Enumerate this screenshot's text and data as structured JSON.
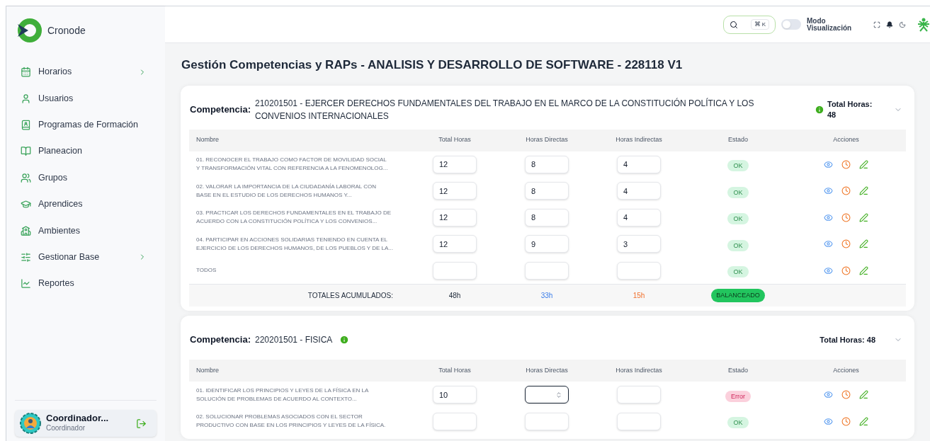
{
  "app": {
    "name": "Cronode"
  },
  "sidebar": {
    "items": [
      {
        "label": "Horarios",
        "has_submenu": true
      },
      {
        "label": "Usuarios",
        "has_submenu": false
      },
      {
        "label": "Programas de Formación",
        "has_submenu": false
      },
      {
        "label": "Planeacion",
        "has_submenu": false
      },
      {
        "label": "Grupos",
        "has_submenu": false
      },
      {
        "label": "Aprendices",
        "has_submenu": false
      },
      {
        "label": "Ambientes",
        "has_submenu": false
      },
      {
        "label": "Gestionar Base",
        "has_submenu": true
      },
      {
        "label": "Reportes",
        "has_submenu": false
      }
    ],
    "user": {
      "name": "Coordinador...",
      "role": "Coordinador"
    }
  },
  "header": {
    "search_shortcut_symbol": "⌘",
    "search_shortcut_key": "K",
    "mode_toggle": {
      "label": "Modo Visualización",
      "on": false
    }
  },
  "page_title": "Gestión Competencias y RAPs - ANALISIS Y DESARROLLO DE SOFTWARE - 228118 V1",
  "competencias": [
    {
      "label": "Competencia:",
      "title": "210201501 - EJERCER DERECHOS FUNDAMENTALES DEL TRABAJO EN EL MARCO DE LA CONSTITUCIÓN POLÍTICA Y LOS CONVENIOS INTERNACIONALES",
      "info_beside_total": true,
      "total": "Total Horas: 48",
      "expanded": true,
      "columns": [
        "Nombre",
        "Total Horas",
        "Horas Directas",
        "Horas Indirectas",
        "Estado",
        "Acciones"
      ],
      "rows": [
        {
          "name": "01. RECONOCER EL TRABAJO COMO FACTOR DE MOVILIDAD SOCIAL\nY TRANSFORMACIÓN VITAL CON REFERENCIA A LA FENOMENOLOG...",
          "total": "12",
          "directas": "8",
          "indirectas": "4",
          "focused": false,
          "error": false,
          "status_text": "OK"
        },
        {
          "name": "02. VALORAR LA IMPORTANCIA DE LA CIUDADANÍA LABORAL CON\nBASE EN EL ESTUDIO DE LOS DERECHOS HUMANOS Y...",
          "total": "12",
          "directas": "8",
          "indirectas": "4",
          "focused": false,
          "error": false,
          "status_text": "OK"
        },
        {
          "name": "03. PRACTICAR LOS DERECHOS FUNDAMENTALES EN EL TRABAJO DE\nACUERDO CON LA CONSTITUCIÓN POLÍTICA Y LOS CONVENIOS...",
          "total": "12",
          "directas": "8",
          "indirectas": "4",
          "focused": false,
          "error": false,
          "status_text": "OK"
        },
        {
          "name": "04. PARTICIPAR EN ACCIONES SOLIDARIAS TENIENDO EN CUENTA EL\nEJERCICIO DE LOS DERECHOS HUMANOS, DE LOS PUEBLOS Y DE LA...",
          "total": "12",
          "directas": "9",
          "indirectas": "3",
          "focused": false,
          "error": false,
          "status_text": "OK"
        },
        {
          "name": "TODOS",
          "focused": false,
          "error": false,
          "status_text": "OK"
        }
      ],
      "totals": {
        "label": "TOTALES ACUMULADOS:",
        "total": "48h",
        "directas": "33h",
        "indirectas": "15h",
        "status": "BALANCEADO"
      }
    },
    {
      "label": "Competencia:",
      "title": "220201501 - FISICA",
      "info_beside_total": false,
      "total": "Total Horas: 48",
      "expanded": true,
      "columns": [
        "Nombre",
        "Total Horas",
        "Horas Directas",
        "Horas Indirectas",
        "Estado",
        "Acciones"
      ],
      "rows": [
        {
          "name": "01. IDENTIFICAR LOS PRINCIPIOS Y LEYES DE LA FÍSICA EN LA\nSOLUCIÓN DE PROBLEMAS DE ACUERDO AL CONTEXTO...",
          "total": "10",
          "focused": true,
          "error": true,
          "status_text": "Error"
        },
        {
          "name": "02. SOLUCIONAR PROBLEMAS ASOCIADOS CON EL SECTOR\nPRODUCTIVO CON BASE EN LOS PRINCIPIOS Y LEYES DE LA FÍSICA.",
          "focused": false,
          "error": false,
          "status_text": "OK"
        }
      ]
    }
  ]
}
